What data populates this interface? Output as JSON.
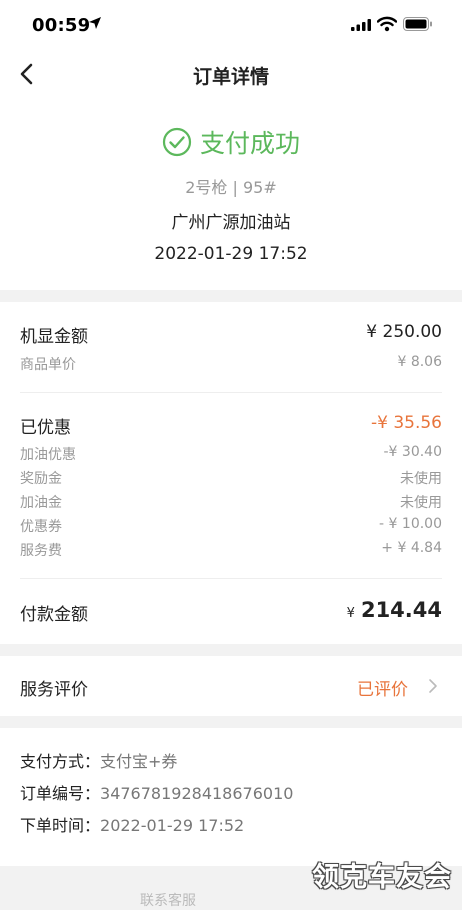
{
  "status_bar": {
    "time": "00:59"
  },
  "nav": {
    "title": "订单详情"
  },
  "hero": {
    "status": "支付成功",
    "pump": "2号枪 | 95#",
    "station": "广州广源加油站",
    "datetime": "2022-01-29 17:52",
    "success_color": "#5cb85c"
  },
  "amounts": {
    "display_label": "机显金额",
    "display_value": "¥ 250.00",
    "unit_price_label": "商品单价",
    "unit_price_value": "¥ 8.06",
    "discount_label": "已优惠",
    "discount_value": "-¥ 35.56",
    "discount_items": [
      {
        "label": "加油优惠",
        "value": "-¥ 30.40"
      },
      {
        "label": "奖励金",
        "value": "未使用"
      },
      {
        "label": "加油金",
        "value": "未使用"
      },
      {
        "label": "优惠券",
        "value": "- ¥ 10.00"
      },
      {
        "label": "服务费",
        "value": "+ ¥ 4.84"
      }
    ],
    "pay_label": "付款金额",
    "pay_currency": "¥",
    "pay_value": "214.44",
    "accent_color": "#e8743b"
  },
  "service": {
    "label": "服务评价",
    "status": "已评价"
  },
  "info": {
    "pay_method_label": "支付方式：",
    "pay_method_value": "支付宝+券",
    "order_no_label": "订单编号：",
    "order_no_value": "3476781928418676010",
    "order_time_label": "下单时间：",
    "order_time_value": "2022-01-29 17:52"
  },
  "watermark": "领克车友会",
  "bottom_peek": "联系客服"
}
